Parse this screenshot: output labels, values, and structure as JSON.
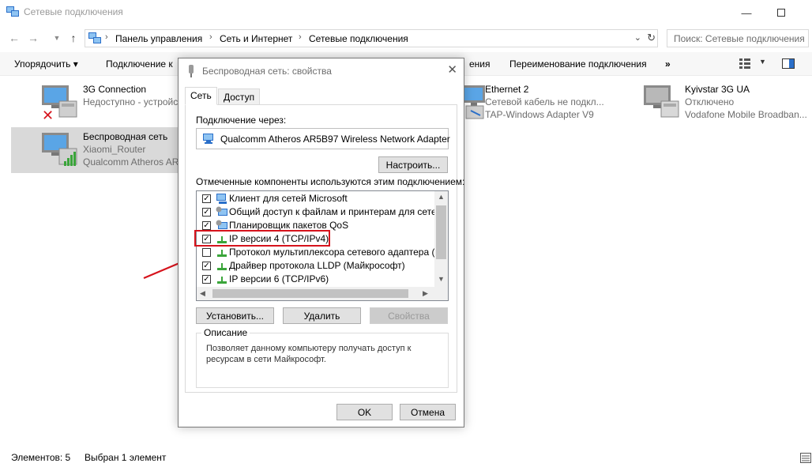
{
  "window": {
    "title": "Сетевые подключения"
  },
  "address": {
    "crumbs": [
      "Панель управления",
      "Сеть и Интернет",
      "Сетевые подключения"
    ],
    "search_placeholder": "Поиск: Сетевые подключения"
  },
  "toolbar": {
    "organize": "Упорядочить ▾",
    "connect": "Подключение к",
    "diagnose_tail": "ения",
    "rename": "Переименование подключения",
    "more": "»"
  },
  "connections": [
    {
      "name": "3G Connection",
      "status": "Недоступно - устройс",
      "device": ""
    },
    {
      "name": "Беспроводная сеть",
      "status": "Xiaomi_Router",
      "device": "Qualcomm Atheros AR"
    },
    {
      "name": "Ethernet 2",
      "status": "Сетевой кабель не подкл...",
      "device": "TAP-Windows Adapter V9"
    },
    {
      "name": "Kyivstar 3G UA",
      "status": "Отключено",
      "device": "Vodafone Mobile Broadban..."
    }
  ],
  "statusbar": {
    "count": "Элементов: 5",
    "selected": "Выбран 1 элемент"
  },
  "dialog": {
    "title": "Беспроводная сеть: свойства",
    "tabs": [
      "Сеть",
      "Доступ"
    ],
    "connect_using_label": "Подключение через:",
    "adapter": "Qualcomm Atheros AR5B97 Wireless Network Adapter",
    "configure": "Настроить...",
    "components_label": "Отмеченные компоненты используются этим подключением:",
    "components": [
      {
        "label": "Клиент для сетей Microsoft",
        "checked": true
      },
      {
        "label": "Общий доступ к файлам и принтерам для сетей Mi",
        "checked": true
      },
      {
        "label": "Планировщик пакетов QoS",
        "checked": true
      },
      {
        "label": "IP версии 4 (TCP/IPv4)",
        "checked": true
      },
      {
        "label": "Протокол мультиплексора сетевого адаптера (Май",
        "checked": false
      },
      {
        "label": "Драйвер протокола LLDP (Майкрософт)",
        "checked": true
      },
      {
        "label": "IP версии 6 (TCP/IPv6)",
        "checked": true
      }
    ],
    "install": "Установить...",
    "uninstall": "Удалить",
    "properties": "Свойства",
    "description_title": "Описание",
    "description": "Позволяет данному компьютеру получать доступ к ресурсам в сети Майкрософт.",
    "ok": "OK",
    "cancel": "Отмена"
  },
  "colors": {
    "highlight": "#d6131c",
    "arrow": "#d6131c",
    "selection": "#d9d9d9"
  }
}
